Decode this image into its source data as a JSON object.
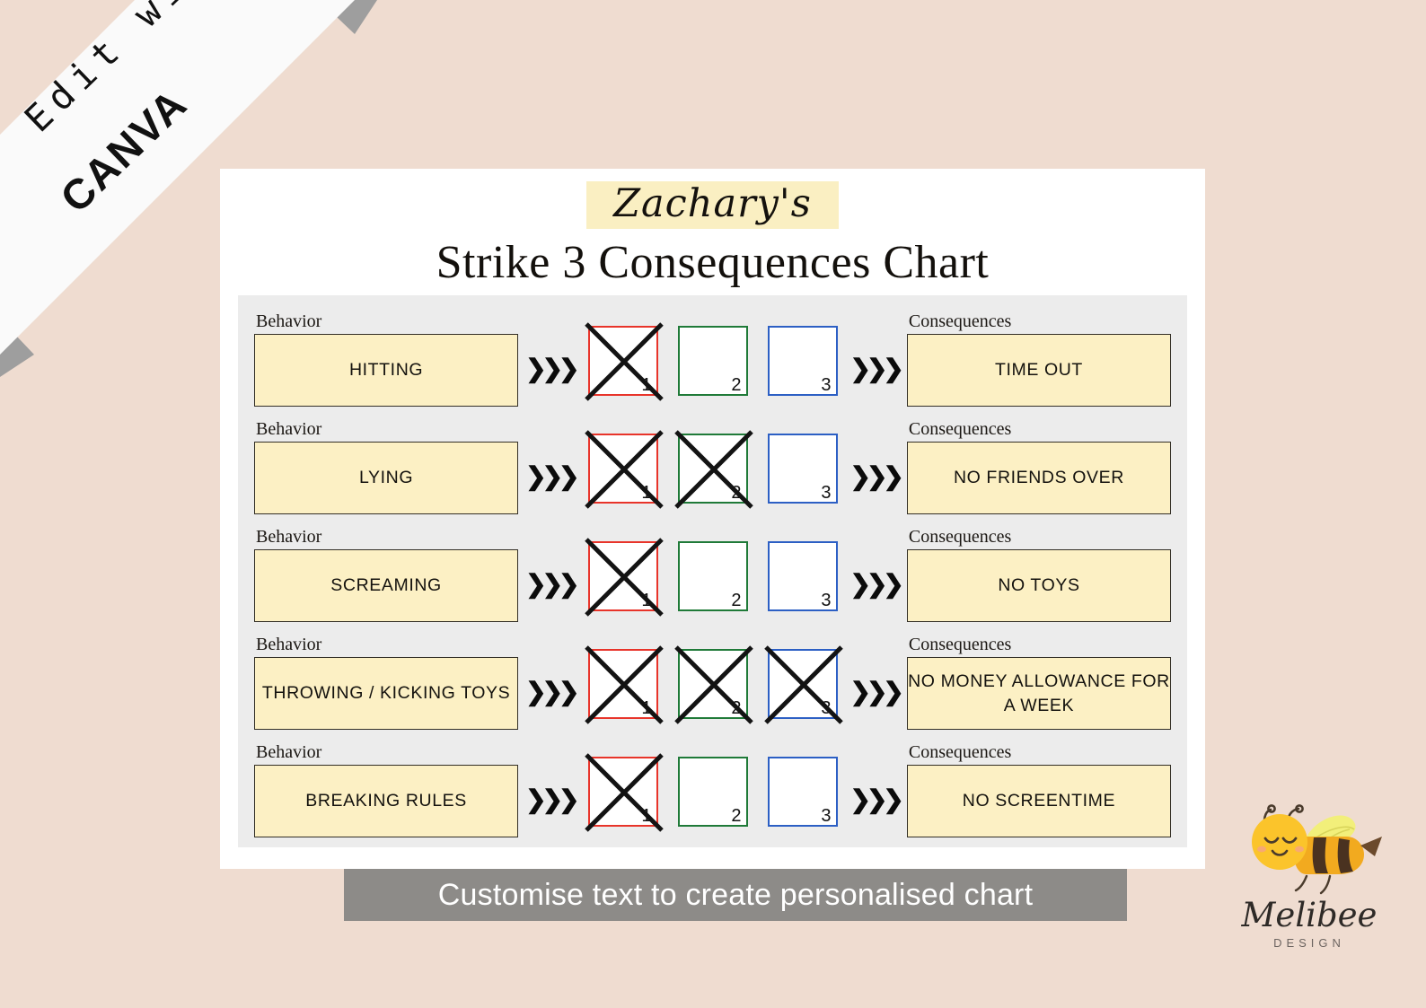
{
  "ribbon": {
    "line1": "Edit with",
    "line2": "CANVA"
  },
  "title": {
    "child_name": "Zachary's",
    "heading": "Strike 3 Consequences Chart",
    "highlight_color": "#FAEFC2"
  },
  "labels": {
    "behavior": "Behavior",
    "consequences": "Consequences",
    "arrow": "❯❯❯"
  },
  "strike_colors": {
    "one": "#e8342a",
    "two": "#1f7a38",
    "three": "#2c5fc4"
  },
  "strike_numbers": [
    "1",
    "2",
    "3"
  ],
  "rows": [
    {
      "behavior": "HITTING",
      "consequence": "TIME OUT",
      "strikes_marked": 1
    },
    {
      "behavior": "LYING",
      "consequence": "NO FRIENDS OVER",
      "strikes_marked": 2
    },
    {
      "behavior": "SCREAMING",
      "consequence": "NO TOYS",
      "strikes_marked": 1
    },
    {
      "behavior": "THROWING / KICKING TOYS",
      "consequence": "NO MONEY ALLOWANCE FOR A WEEK",
      "strikes_marked": 3
    },
    {
      "behavior": "BREAKING RULES",
      "consequence": "NO SCREENTIME",
      "strikes_marked": 1
    }
  ],
  "banner": {
    "text": "Customise text to create personalised chart",
    "background": "#8D8B88"
  },
  "logo": {
    "name": "Melibee",
    "sub": "DESIGN"
  },
  "theme": {
    "page_background": "#EFDCD0",
    "card_background": "#FFFFFF",
    "panel_background": "#ECECEC",
    "box_fill": "#FCF0C4"
  }
}
